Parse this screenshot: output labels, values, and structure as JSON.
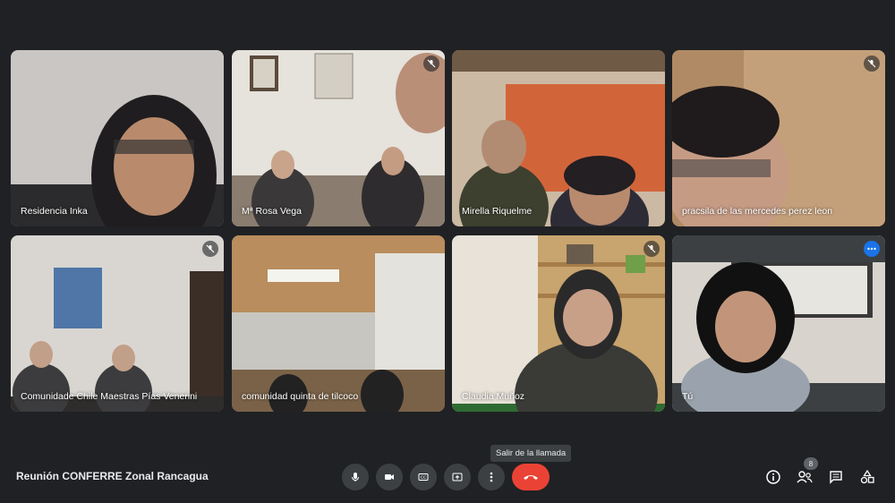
{
  "participants": [
    {
      "name": "Residencia Inka",
      "muted": false
    },
    {
      "name": "Mª Rosa Vega",
      "muted": true
    },
    {
      "name": "Mirella Riquelme",
      "muted": false
    },
    {
      "name": "pracsila de las mercedes perez leon",
      "muted": true
    },
    {
      "name": "Comunidade Chile Maestras Pías Venerini",
      "muted": true
    },
    {
      "name": "comunidad quinta de tilcoco",
      "muted": false
    },
    {
      "name": "Claudia Muñoz",
      "muted": true
    },
    {
      "name": "Tú",
      "muted": false
    }
  ],
  "meeting": {
    "title": "Reunión CONFERRE Zonal Rancagua"
  },
  "tooltip": "Salir de la llamada",
  "participants_count": "8",
  "icons": [
    "mic-icon",
    "camera-icon",
    "captions-icon",
    "present-icon",
    "more-icon",
    "end-call-icon",
    "info-icon",
    "people-icon",
    "chat-icon",
    "activities-icon"
  ],
  "colors": {
    "background": "#202124",
    "end_call": "#ea4335",
    "self_outline": "#8ab4f8",
    "accent": "#1a73e8"
  }
}
